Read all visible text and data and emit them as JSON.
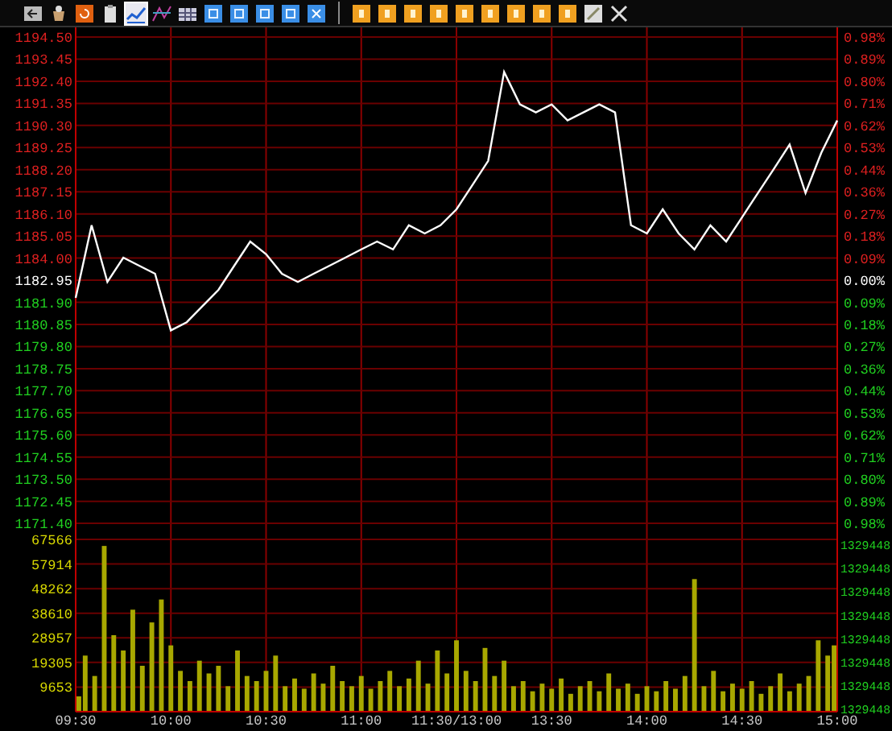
{
  "toolbar": {
    "groups": [
      [
        {
          "kind": "back",
          "selected": false
        },
        {
          "kind": "cup",
          "selected": false
        },
        {
          "kind": "refresh",
          "selected": false
        },
        {
          "kind": "clipboard",
          "selected": false
        },
        {
          "kind": "chart",
          "selected": true
        },
        {
          "kind": "layers",
          "selected": false
        },
        {
          "kind": "grid",
          "selected": false
        },
        {
          "kind": "frame",
          "selected": false
        },
        {
          "kind": "frame",
          "selected": false
        },
        {
          "kind": "frame",
          "selected": false
        },
        {
          "kind": "frame",
          "selected": false
        },
        {
          "kind": "frame-x",
          "selected": false
        }
      ],
      [
        {
          "kind": "tile",
          "selected": false
        },
        {
          "kind": "tile",
          "selected": false
        },
        {
          "kind": "tile",
          "selected": false
        },
        {
          "kind": "tile",
          "selected": false
        },
        {
          "kind": "tile",
          "selected": false
        },
        {
          "kind": "tile",
          "selected": false
        },
        {
          "kind": "tile",
          "selected": false
        },
        {
          "kind": "tile",
          "selected": false
        },
        {
          "kind": "tile",
          "selected": false
        },
        {
          "kind": "pen",
          "selected": false
        },
        {
          "kind": "close",
          "selected": false
        }
      ]
    ]
  },
  "price_panel": {
    "right_axis_labels": [
      {
        "text": "0.98%",
        "color": "#e02020"
      },
      {
        "text": "0.89%",
        "color": "#e02020"
      },
      {
        "text": "0.80%",
        "color": "#e02020"
      },
      {
        "text": "0.71%",
        "color": "#e02020"
      },
      {
        "text": "0.62%",
        "color": "#e02020"
      },
      {
        "text": "0.53%",
        "color": "#e02020"
      },
      {
        "text": "0.44%",
        "color": "#e02020"
      },
      {
        "text": "0.36%",
        "color": "#e02020"
      },
      {
        "text": "0.27%",
        "color": "#e02020"
      },
      {
        "text": "0.18%",
        "color": "#e02020"
      },
      {
        "text": "0.09%",
        "color": "#e02020"
      },
      {
        "text": "0.00%",
        "color": "#ffffff"
      },
      {
        "text": "0.09%",
        "color": "#20d020"
      },
      {
        "text": "0.18%",
        "color": "#20d020"
      },
      {
        "text": "0.27%",
        "color": "#20d020"
      },
      {
        "text": "0.36%",
        "color": "#20d020"
      },
      {
        "text": "0.44%",
        "color": "#20d020"
      },
      {
        "text": "0.53%",
        "color": "#20d020"
      },
      {
        "text": "0.62%",
        "color": "#20d020"
      },
      {
        "text": "0.71%",
        "color": "#20d020"
      },
      {
        "text": "0.80%",
        "color": "#20d020"
      },
      {
        "text": "0.89%",
        "color": "#20d020"
      },
      {
        "text": "0.98%",
        "color": "#20d020"
      }
    ],
    "chart_data": {
      "type": "line",
      "grid": true,
      "series": [
        {
          "color": "#ffffff",
          "values": [
            1182.11,
            1185.56,
            1182.87,
            1184.02,
            1183.64,
            1183.26,
            1180.57,
            1180.96,
            1181.72,
            1182.49,
            1183.64,
            1184.79,
            1184.18,
            1183.26,
            1182.87,
            1183.26,
            1183.64,
            1184.02,
            1184.41,
            1184.79,
            1184.41,
            1185.56,
            1185.17,
            1185.56,
            1186.32,
            1187.47,
            1188.62,
            1192.84,
            1191.3,
            1190.92,
            1191.3,
            1190.54,
            1190.92,
            1191.3,
            1190.92,
            1185.56,
            1185.17,
            1186.32,
            1185.17,
            1184.41,
            1185.56,
            1184.79,
            1185.94,
            1187.09,
            1188.24,
            1189.39,
            1187.09,
            1189.0,
            1190.54
          ]
        }
      ],
      "ylim": [
        1171.4,
        1194.5
      ],
      "yticks": [
        {
          "value": 1194.5,
          "label": "1194.50"
        },
        {
          "value": 1193.45,
          "label": "1193.45"
        },
        {
          "value": 1192.4,
          "label": "1192.40"
        },
        {
          "value": 1191.35,
          "label": "1191.35"
        },
        {
          "value": 1190.3,
          "label": "1190.30"
        },
        {
          "value": 1189.25,
          "label": "1189.25"
        },
        {
          "value": 1188.2,
          "label": "1188.20"
        },
        {
          "value": 1187.15,
          "label": "1187.15"
        },
        {
          "value": 1186.1,
          "label": "1186.10"
        },
        {
          "value": 1185.05,
          "label": "1185.05"
        },
        {
          "value": 1184.0,
          "label": "1184.00"
        },
        {
          "value": 1182.95,
          "label": "1182.95"
        },
        {
          "value": 1181.9,
          "label": "1181.90"
        },
        {
          "value": 1180.85,
          "label": "1180.85"
        },
        {
          "value": 1179.8,
          "label": "1179.80"
        },
        {
          "value": 1178.75,
          "label": "1178.75"
        },
        {
          "value": 1177.7,
          "label": "1177.70"
        },
        {
          "value": 1176.65,
          "label": "1176.65"
        },
        {
          "value": 1175.6,
          "label": "1175.60"
        },
        {
          "value": 1174.55,
          "label": "1174.55"
        },
        {
          "value": 1173.5,
          "label": "1173.50"
        },
        {
          "value": 1172.45,
          "label": "1172.45"
        },
        {
          "value": 1171.4,
          "label": "1171.40"
        }
      ]
    }
  },
  "volume_panel": {
    "right_axis_labels": [
      "1329448",
      "1329448",
      "1329448",
      "1329448",
      "1329448",
      "1329448",
      "1329448",
      "1329448"
    ],
    "chart_data": {
      "type": "bar",
      "grid": true,
      "categories": [
        "09:30",
        null,
        null,
        null,
        null,
        null,
        null,
        null,
        null,
        null,
        "10:00",
        null,
        null,
        null,
        null,
        null,
        null,
        null,
        null,
        null,
        "10:30",
        null,
        null,
        null,
        null,
        null,
        null,
        null,
        null,
        null,
        "11:00",
        null,
        null,
        null,
        null,
        null,
        null,
        null,
        null,
        null,
        "11:30/13:00",
        null,
        null,
        null,
        null,
        null,
        null,
        null,
        null,
        null,
        "13:30",
        null,
        null,
        null,
        null,
        null,
        null,
        null,
        null,
        null,
        "14:00",
        null,
        null,
        null,
        null,
        null,
        null,
        null,
        null,
        null,
        "14:30",
        null,
        null,
        null,
        null,
        null,
        null,
        null,
        null,
        null,
        "15:00"
      ],
      "series": [
        {
          "color": "#a8a800",
          "values": [
            6000,
            22000,
            14000,
            65000,
            30000,
            24000,
            40000,
            18000,
            35000,
            44000,
            26000,
            16000,
            12000,
            20000,
            15000,
            18000,
            10000,
            24000,
            14000,
            12000,
            16000,
            22000,
            10000,
            13000,
            9000,
            15000,
            11000,
            18000,
            12000,
            10000,
            14000,
            9000,
            12000,
            16000,
            10000,
            13000,
            20000,
            11000,
            24000,
            15000,
            28000,
            16000,
            12000,
            25000,
            14000,
            20000,
            10000,
            12000,
            8000,
            11000,
            9000,
            13000,
            7000,
            10000,
            12000,
            8000,
            15000,
            9000,
            11000,
            7000,
            10000,
            8000,
            12000,
            9000,
            14000,
            52000,
            10000,
            16000,
            8000,
            11000,
            9000,
            12000,
            7000,
            10000,
            15000,
            8000,
            11000,
            14000,
            28000,
            22000,
            26000
          ]
        }
      ],
      "ylim": [
        0,
        67566
      ],
      "yticks": [
        {
          "value": 67566,
          "label": "67566"
        },
        {
          "value": 57914,
          "label": "57914"
        },
        {
          "value": 48262,
          "label": "48262"
        },
        {
          "value": 38610,
          "label": "38610"
        },
        {
          "value": 28957,
          "label": "28957"
        },
        {
          "value": 19305,
          "label": "19305"
        },
        {
          "value": 9653,
          "label": "9653"
        }
      ]
    }
  }
}
